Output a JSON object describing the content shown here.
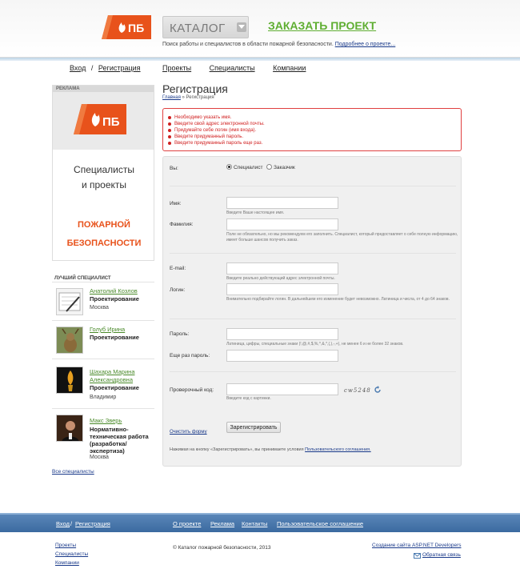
{
  "header": {
    "logo_text": "ПБ",
    "catalog_label": "КАТАЛОГ",
    "order_link": "ЗАКАЗАТЬ ПРОЕКТ",
    "tagline": "Поиск работы и специалистов в области пожарной безопасности.",
    "tagline_link": "Подробнее о проекте..."
  },
  "nav": {
    "login": "Вход",
    "sep": "/",
    "register": "Регистрация",
    "items": [
      "Проекты",
      "Специалисты",
      "Компании"
    ]
  },
  "sidebar": {
    "ad_title": "РЕКЛАМА",
    "ad_logo_text": "ПБ",
    "ad_line1": "Специалисты",
    "ad_line2": "и проекты",
    "ad_line3": "ПОЖАРНОЙ",
    "ad_line4": "БЕЗОПАСНОСТИ",
    "best_title": "ЛУЧШИЙ СПЕЦИАЛИСТ",
    "specialists": [
      {
        "name": "Анатолий Козлов",
        "role": "Проектирование",
        "city": "Москва"
      },
      {
        "name": "Голуб Ирина",
        "role": "Проектирование",
        "city": ""
      },
      {
        "name": "Шахара Марина Александровна",
        "name_l1": "Шахара Марина",
        "name_l2": "Александровна",
        "role": "Проектирование",
        "city": "Владимир"
      },
      {
        "name": "Макс Зверь",
        "role_l1": "Нормативно-",
        "role_l2": "техническая работа",
        "role_l3": "(разработка/",
        "role_l4": "экспертиза)",
        "city": "Москва"
      }
    ],
    "all_link": "Все специалисты"
  },
  "main": {
    "title": "Регистрация",
    "crumb_home": "Главная",
    "crumb_sep": "»",
    "crumb_current": "Регистрация",
    "errors": [
      "Необходимо указать имя.",
      "Введите свой адрес электронной почты.",
      "Придумайте себе логин (имя входа).",
      "Введите придуманный пароль.",
      "Введите придуманный пароль еще раз."
    ]
  },
  "form": {
    "you_label": "Вы:",
    "radio_specialist": "Специалист",
    "radio_customer": "Заказчик",
    "name_label": "Имя:",
    "name_hint": "Введите Ваше настоящее имя.",
    "surname_label": "Фамилия:",
    "surname_hint": "Поле не обязательно, но мы рекомендуем его заполнить. Специалист, который предоставляет о себе полную информацию, имеет больше шансов получить заказ.",
    "email_label": "E-mail:",
    "email_hint": "Введите реально действующий адрес электронной почты.",
    "login_label": "Логин:",
    "login_hint": "Внимательно подбирайте логин. В дальнейшем его изменение будет невозможно. Латиница и числа, от 4 до 64 знаков.",
    "password_label": "Пароль:",
    "password_hint": "Латиница, цифры, специальные знаки (!,@,#,$,%,^,&,*,(,),-,+), не менее 6 и не более 32 знаков.",
    "password2_label": "Еще раз пароль:",
    "captcha_label": "Проверочный код:",
    "captcha_hint": "Введите код с картинки.",
    "captcha_text": "cw5248",
    "clear_link": "Очистить форму",
    "submit_label": "Зарегистрировать",
    "agree_text": "Нажимая на кнопку «Зарегистрировать», вы принимаете условия",
    "agree_link": "Пользовательского соглашения."
  },
  "footer": {
    "login": "Вход",
    "sep": "/",
    "register": "Регистрация",
    "links": [
      "О проекте",
      "Реклама",
      "Контакты",
      "Пользовательское соглашение"
    ],
    "col_links": [
      "Проекты",
      "Специалисты",
      "Компании"
    ],
    "copyright": "© Каталог пожарной безопасности, 2013",
    "created": "Создание сайта ASP.NET Developers",
    "feedback": "Обратная связь"
  },
  "colors": {
    "logo_orange": "#e8521b",
    "order_green": "#5fae32",
    "error_red": "#d02020",
    "footer_blue": "#3b6aa0"
  }
}
